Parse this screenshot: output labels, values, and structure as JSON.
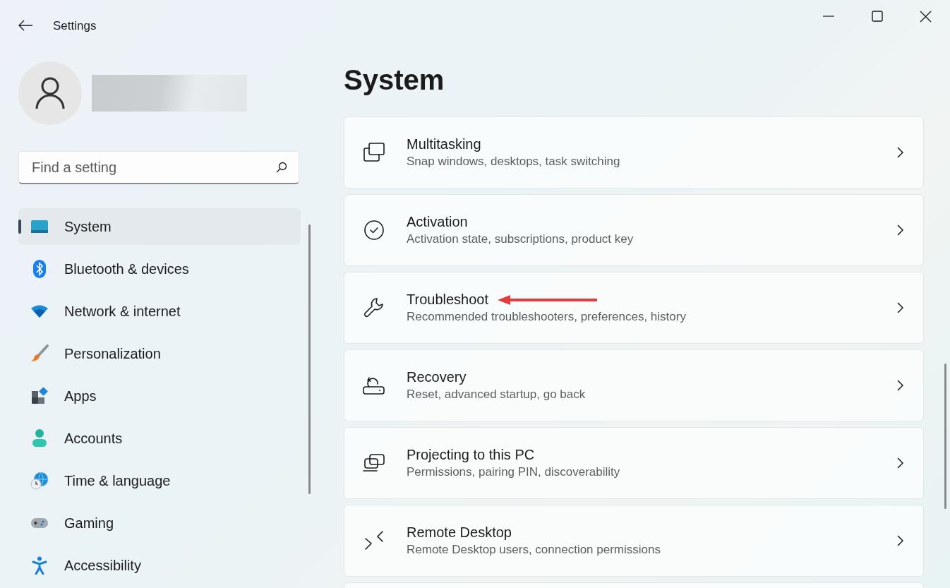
{
  "window": {
    "title": "Settings"
  },
  "search": {
    "placeholder": "Find a setting"
  },
  "sidebar": {
    "items": [
      {
        "label": "System",
        "selected": true
      },
      {
        "label": "Bluetooth & devices",
        "selected": false
      },
      {
        "label": "Network & internet",
        "selected": false
      },
      {
        "label": "Personalization",
        "selected": false
      },
      {
        "label": "Apps",
        "selected": false
      },
      {
        "label": "Accounts",
        "selected": false
      },
      {
        "label": "Time & language",
        "selected": false
      },
      {
        "label": "Gaming",
        "selected": false
      },
      {
        "label": "Accessibility",
        "selected": false
      }
    ]
  },
  "page": {
    "title": "System"
  },
  "settings": [
    {
      "title": "Multitasking",
      "description": "Snap windows, desktops, task switching",
      "annotated": false
    },
    {
      "title": "Activation",
      "description": "Activation state, subscriptions, product key",
      "annotated": false
    },
    {
      "title": "Troubleshoot",
      "description": "Recommended troubleshooters, preferences, history",
      "annotated": true
    },
    {
      "title": "Recovery",
      "description": "Reset, advanced startup, go back",
      "annotated": false
    },
    {
      "title": "Projecting to this PC",
      "description": "Permissions, pairing PIN, discoverability",
      "annotated": false
    },
    {
      "title": "Remote Desktop",
      "description": "Remote Desktop users, connection permissions",
      "annotated": false
    }
  ]
}
